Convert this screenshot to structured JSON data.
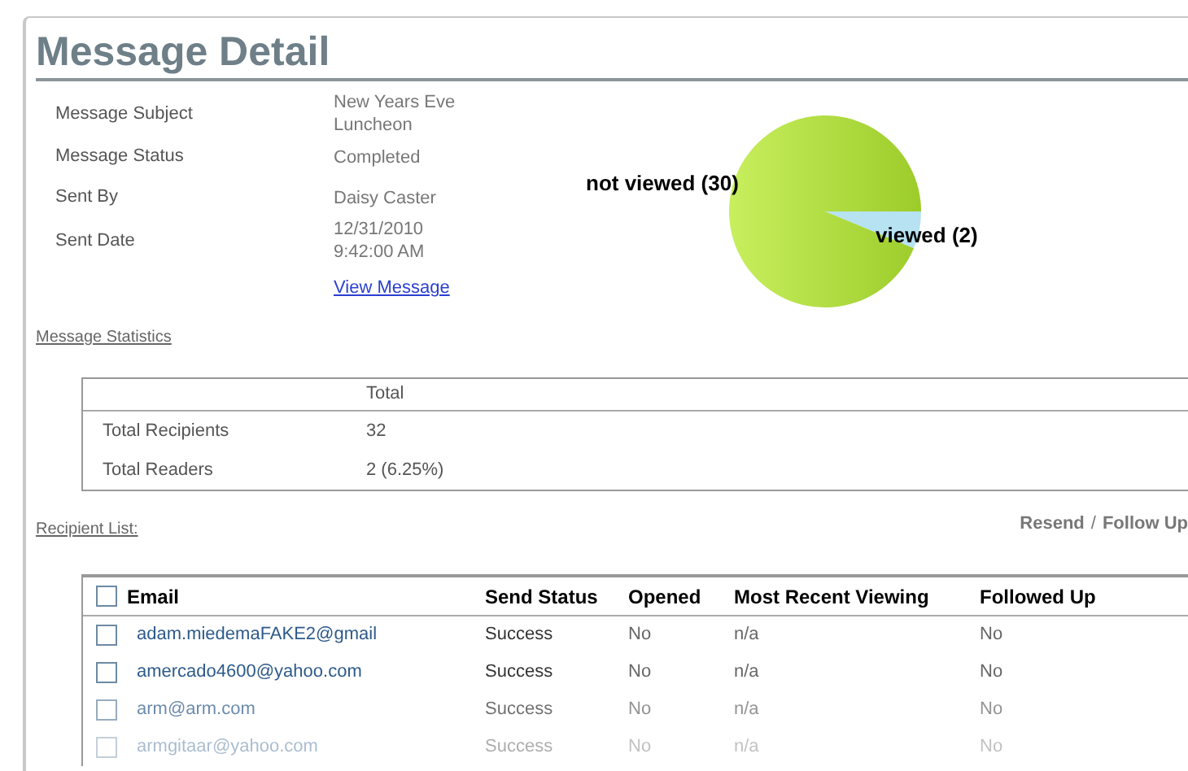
{
  "page": {
    "title": "Message Detail"
  },
  "details": [
    {
      "label": "Message Subject",
      "value": "New Years Eve Luncheon"
    },
    {
      "label": "Message Status",
      "value": "Completed"
    },
    {
      "label": "Sent By",
      "value": "Daisy Caster"
    },
    {
      "label": "Sent Date",
      "value": "12/31/2010 9:42:00 AM"
    }
  ],
  "view_message_link": "View Message",
  "statistics_link": "Message Statistics",
  "chart": {
    "chart_data": {
      "type": "pie",
      "categories": [
        "not viewed (30)",
        "viewed (2)"
      ],
      "values": [
        30,
        2
      ]
    }
  },
  "statistics": {
    "columns": [
      "Total"
    ],
    "rows": [
      {
        "label": "Total Recipients",
        "value": "32"
      },
      {
        "label": "Total Readers",
        "value": "2 (6.25%)"
      }
    ]
  },
  "recipient_list_link": "Recipient List:",
  "actions": [
    "Resend",
    "/",
    "Follow Up"
  ],
  "recipients": {
    "select_all": {
      "checked": false
    },
    "columns": [
      "Email",
      "Send Status",
      "Opened",
      "Most Recent Viewing",
      "Followed Up"
    ],
    "rows": [
      {
        "checked": false,
        "cells": [
          "adam.miedemaFAKE2@gmail",
          "Success",
          "No",
          "n/a",
          "No"
        ]
      },
      {
        "checked": false,
        "cells": [
          "amercado4600@yahoo.com",
          "Success",
          "No",
          "n/a",
          "No"
        ]
      },
      {
        "checked": false,
        "cells": [
          "arm@arm.com",
          "Success",
          "No",
          "n/a",
          "No"
        ]
      },
      {
        "checked": false,
        "cells": [
          "armgitaar@yahoo.com",
          "Success",
          "No",
          "n/a",
          "No"
        ]
      }
    ]
  }
}
